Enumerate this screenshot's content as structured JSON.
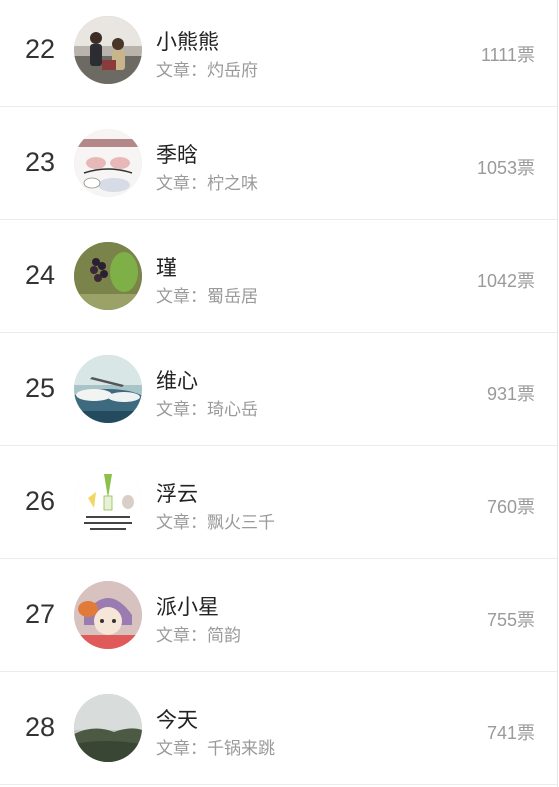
{
  "ranking": [
    {
      "rank": "22",
      "name": "小熊熊",
      "article_prefix": "文章：",
      "article": "灼岳府",
      "votes": "1111票",
      "avatar": "group-photo-avatar"
    },
    {
      "rank": "23",
      "name": "季晗",
      "article_prefix": "文章：",
      "article": "柠之味",
      "votes": "1053票",
      "avatar": "cartoon-sticker-avatar"
    },
    {
      "rank": "24",
      "name": "瑾",
      "article_prefix": "文章：",
      "article": "蜀岳居",
      "votes": "1042票",
      "avatar": "berries-plant-avatar"
    },
    {
      "rank": "25",
      "name": "维心",
      "article_prefix": "文章：",
      "article": "琦心岳",
      "votes": "931票",
      "avatar": "sky-plane-avatar"
    },
    {
      "rank": "26",
      "name": "浮云",
      "article_prefix": "文章：",
      "article": "飘火三千",
      "votes": "760票",
      "avatar": "vegetable-sticker-avatar"
    },
    {
      "rank": "27",
      "name": "派小星",
      "article_prefix": "文章：",
      "article": "简韵",
      "votes": "755票",
      "avatar": "anime-girl-avatar"
    },
    {
      "rank": "28",
      "name": "今天",
      "article_prefix": "文章：",
      "article": "千锅来跳",
      "votes": "741票",
      "avatar": "landscape-avatar"
    }
  ]
}
